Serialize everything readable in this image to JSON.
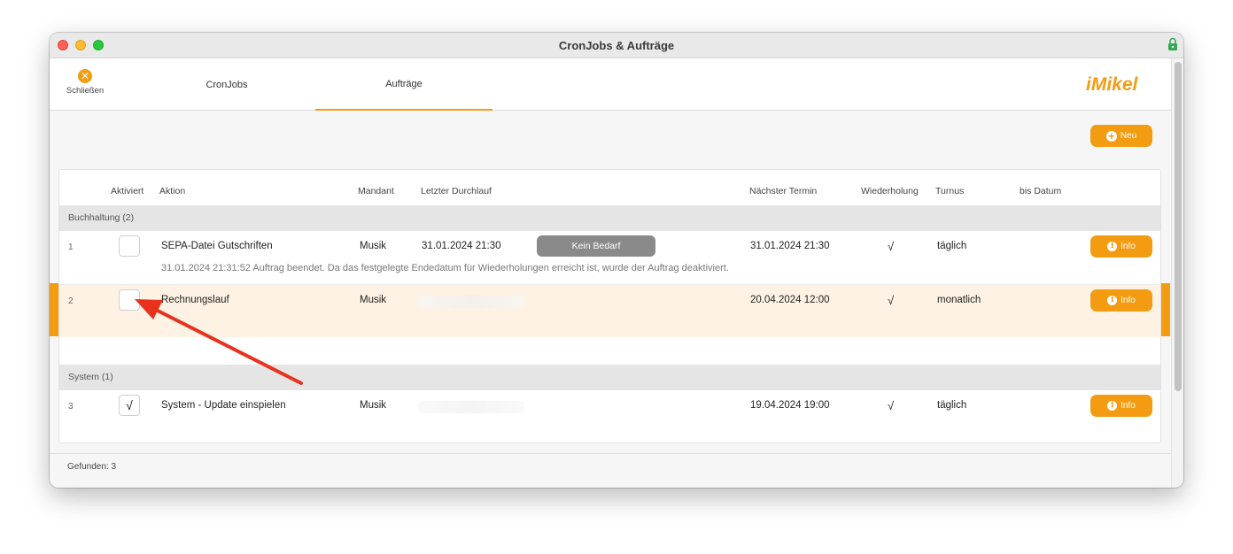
{
  "window": {
    "title": "CronJobs & Aufträge"
  },
  "toolbar": {
    "close_label": "Schließen",
    "tabs": [
      {
        "label": "CronJobs",
        "active": false
      },
      {
        "label": "Aufträge",
        "active": true
      }
    ],
    "logo_text": "iMikel"
  },
  "actions": {
    "new_label": "Neu"
  },
  "table": {
    "columns": [
      "Aktiviert",
      "Aktion",
      "Mandant",
      "Letzter Durchlauf",
      "Nächster Termin",
      "Wiederholung",
      "Turnus",
      "bis Datum"
    ],
    "groups": [
      {
        "label": "Buchhaltung (2)",
        "rows": [
          {
            "num": "1",
            "aktiviert": false,
            "aktion": "SEPA-Datei Gutschriften",
            "mandant": "Musik",
            "letzter_durchlauf": "31.01.2024 21:30",
            "status_pill": "Kein Bedarf",
            "naechster_termin": "31.01.2024 21:30",
            "wiederholung": "√",
            "turnus": "täglich",
            "message": "31.01.2024 21:31:52 Auftrag beendet. Da das festgelegte Endedatum für Wiederholungen erreicht ist, wurde der Auftrag deaktiviert.",
            "info_label": "Info"
          },
          {
            "num": "2",
            "aktiviert": false,
            "aktion": "Rechnungslauf",
            "mandant": "Musik",
            "naechster_termin": "20.04.2024 12:00",
            "wiederholung": "√",
            "turnus": "monatlich",
            "info_label": "Info",
            "selected": true
          }
        ]
      },
      {
        "label": "System (1)",
        "rows": [
          {
            "num": "3",
            "aktiviert": true,
            "check_glyph": "√",
            "aktion": "System - Update einspielen",
            "mandant": "Musik",
            "naechster_termin": "19.04.2024 19:00",
            "wiederholung": "√",
            "turnus": "täglich",
            "info_label": "Info"
          }
        ]
      }
    ]
  },
  "footer": {
    "found_text": "Gefunden: 3"
  },
  "colors": {
    "accent": "#f39c12",
    "annotation_arrow": "#e8321e",
    "selected_row": "#fdf2e4"
  }
}
